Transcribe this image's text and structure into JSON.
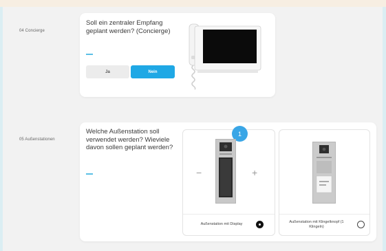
{
  "sections": [
    {
      "label": "04 Concierge",
      "question": "Soll ein zentraler Empfang geplant werden? (Concierge)",
      "buttons": {
        "yes": "Ja",
        "no": "Nein"
      },
      "selected": "Nein",
      "image": "concierge-monitor-phone"
    },
    {
      "label": "05 Außenstationen",
      "question": "Welche Außenstation soll verwendet werden? Wieviele davon sollen geplant werden?",
      "options": [
        {
          "label": "Außenstation mit Display",
          "selected": true,
          "count": "1",
          "image": "door-station-display"
        },
        {
          "label": "Außenstation mit Klingelknopf (1 Klingeln)",
          "selected": false,
          "image": "door-station-bell-button"
        }
      ],
      "stepper": {
        "minus": "−",
        "plus": "+"
      }
    }
  ],
  "colors": {
    "accent": "#1fa8e5",
    "badge": "#3aa6e6",
    "background": "#f2f2f2"
  }
}
